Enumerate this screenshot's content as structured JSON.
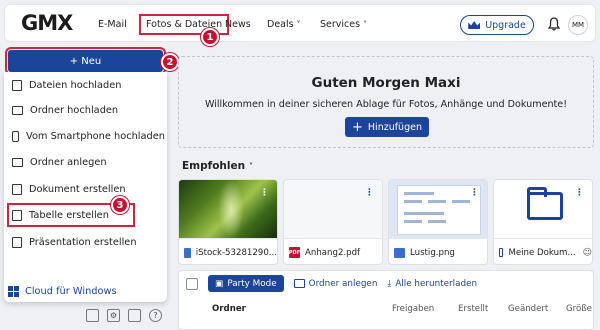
{
  "header": {
    "logo": "GMX",
    "nav": [
      {
        "label": "E-Mail",
        "has_chevron": false
      },
      {
        "label": "Fotos & Dateien",
        "has_chevron": false,
        "active": true
      },
      {
        "label": "News",
        "has_chevron": false
      },
      {
        "label": "Deals",
        "has_chevron": true
      },
      {
        "label": "Services",
        "has_chevron": true
      }
    ],
    "upgrade_label": "Upgrade",
    "avatar_initials": "MM"
  },
  "annotations": [
    "1",
    "2",
    "3"
  ],
  "sidebar": {
    "new_button": "+ Neu",
    "menu": [
      {
        "label": "Dateien hochladen",
        "icon": "upload-file-icon"
      },
      {
        "label": "Ordner hochladen",
        "icon": "upload-folder-icon"
      },
      {
        "label": "Vom Smartphone hochladen",
        "icon": "smartphone-icon"
      },
      {
        "label": "Ordner anlegen",
        "icon": "new-folder-icon"
      },
      {
        "label": "Dokument erstellen",
        "icon": "document-icon"
      },
      {
        "label": "Tabelle erstellen",
        "icon": "spreadsheet-icon",
        "highlighted": true
      },
      {
        "label": "Präsentation erstellen",
        "icon": "presentation-icon"
      }
    ],
    "cloud_windows": "Cloud für Windows"
  },
  "main": {
    "greeting": "Guten Morgen Maxi",
    "welcome": "Willkommen in deiner sicheren Ablage für Fotos, Anhänge und Dokumente!",
    "add_button": "Hinzufügen",
    "recommended_title": "Empfohlen",
    "cards": [
      {
        "name": "iStock-53281290...",
        "type": "image"
      },
      {
        "name": "Anhang2.pdf",
        "type": "pdf"
      },
      {
        "name": "Lustig.png",
        "type": "image"
      },
      {
        "name": "Meine Dokum...",
        "type": "folder"
      }
    ],
    "toolbar": {
      "party_mode": "Party Mode",
      "create_folder": "Ordner anlegen",
      "download_all": "Alle herunterladen"
    },
    "columns": [
      "Ordner",
      "Freigaben",
      "Erstellt",
      "Geändert",
      "Größe"
    ]
  },
  "colors": {
    "brand_blue": "#1c449b",
    "annotation_red": "#c8102e"
  }
}
